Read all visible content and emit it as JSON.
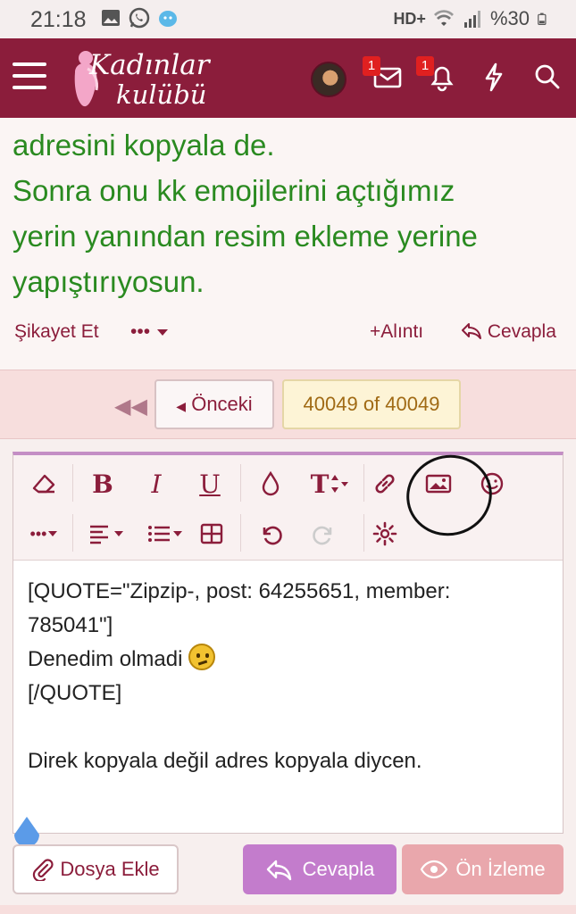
{
  "status_bar": {
    "time": "21:18",
    "network": "HD+",
    "battery": "%30"
  },
  "header": {
    "logo_line1": "Kadınlar",
    "logo_line2": "kulübü",
    "messages_badge": "1",
    "alerts_badge": "1",
    "brand_color": "#8b1d3b"
  },
  "message": {
    "lines": [
      "adresini kopyala de.",
      "Sonra onu kk emojilerini açtığımız",
      "yerin yanından resim ekleme yerine",
      "yapıştırıyosun."
    ],
    "text_color": "#2a8a20",
    "report_label": "Şikayet Et",
    "more_label": "•••",
    "quote_label": "Alıntı",
    "reply_label": "Cevapla"
  },
  "pager": {
    "prev_label": "Önceki",
    "page_info": "40049 of 40049"
  },
  "editor": {
    "content_lines": [
      "[QUOTE=\"Zipzip-, post: 64255651, member:",
      "785041\"]",
      "Denedim olmadi",
      "[/QUOTE]",
      "",
      "Direk kopyala değil adres kopyala diycen."
    ],
    "toolbar_row1": [
      "eraser-icon",
      "bold-icon",
      "italic-icon",
      "underline-icon",
      "color-drop-icon",
      "text-size-icon",
      "link-icon",
      "image-icon",
      "smiley-icon"
    ],
    "toolbar_row2": [
      "more-icon",
      "align-icon",
      "list-icon",
      "table-icon",
      "undo-icon",
      "redo-icon",
      "settings-icon"
    ]
  },
  "actions": {
    "attach_label": "Dosya Ekle",
    "reply_label": "Cevapla",
    "preview_label": "Ön İzleme"
  }
}
